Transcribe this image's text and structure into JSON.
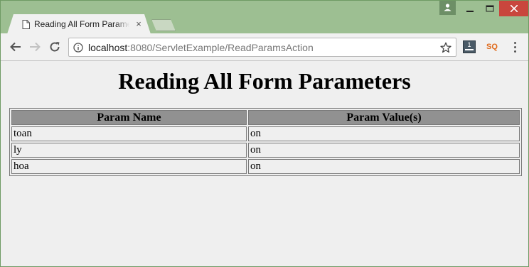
{
  "browser": {
    "tab": {
      "title": "Reading All Form Parameters",
      "close_glyph": "×"
    },
    "address": {
      "host": "localhost",
      "rest": ":8080/ServletExample/ReadParamsAction"
    },
    "extensions": {
      "ext1_label": "1",
      "ext2_label": "SQ"
    },
    "icons": [
      "page-icon",
      "close-icon",
      "back-icon",
      "forward-icon",
      "reload-icon",
      "info-icon",
      "star-icon",
      "profile-icon",
      "minimize-icon",
      "maximize-icon",
      "window-close-icon",
      "menu-icon"
    ],
    "colors": {
      "frame": "#9dbf92",
      "close_button": "#c9463d",
      "header_cell": "#919191",
      "page_bg": "#efefef"
    }
  },
  "page": {
    "title": "Reading All Form Parameters",
    "table": {
      "headers": [
        "Param Name",
        "Param Value(s)"
      ],
      "rows": [
        [
          "toan",
          "on"
        ],
        [
          "ly",
          "on"
        ],
        [
          "hoa",
          "on"
        ]
      ]
    }
  }
}
